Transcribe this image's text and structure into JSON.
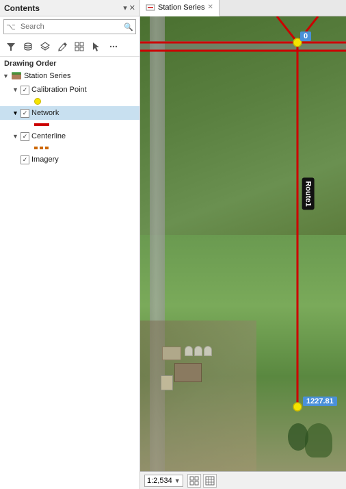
{
  "panel": {
    "title": "Contents",
    "close_hint": "▾ ✕",
    "search_placeholder": "Search",
    "drawing_order_label": "Drawing Order",
    "toolbar_icons": [
      "filter",
      "database",
      "layers",
      "pencil",
      "grid",
      "arrow",
      "more"
    ],
    "layers": [
      {
        "id": "station-series",
        "name": "Station Series",
        "type": "group",
        "expanded": true,
        "checked": true,
        "icon": "group"
      },
      {
        "id": "calibration-point",
        "name": "Calibration Point",
        "type": "layer",
        "checked": true,
        "symbol": "circle",
        "indent": 1
      },
      {
        "id": "network",
        "name": "Network",
        "type": "layer",
        "checked": true,
        "selected": true,
        "symbol": "line-red",
        "indent": 1
      },
      {
        "id": "centerline",
        "name": "Centerline",
        "type": "layer",
        "checked": true,
        "symbol": "line-orange",
        "indent": 1
      },
      {
        "id": "imagery",
        "name": "Imagery",
        "type": "layer",
        "checked": true,
        "symbol": null,
        "indent": 1
      }
    ]
  },
  "map": {
    "tab_label": "Station Series",
    "point_top_label": "0",
    "point_bottom_label": "1227.81",
    "route_label": "Route1",
    "scale": "1:2,534"
  }
}
